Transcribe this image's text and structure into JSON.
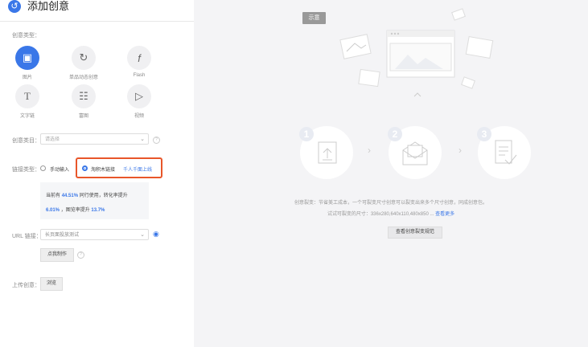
{
  "header": {
    "title": "添加创意",
    "back_icon": "back-arrow-icon"
  },
  "creative_type": {
    "label": "创意类型：",
    "items": [
      {
        "label": "图片",
        "icon": "image-icon",
        "active": true
      },
      {
        "label": "单品动态创意",
        "icon": "refresh-icon",
        "active": false
      },
      {
        "label": "Flash",
        "icon": "flash-icon",
        "active": false
      },
      {
        "label": "文字链",
        "icon": "text-icon",
        "active": false
      },
      {
        "label": "富图",
        "icon": "rich-media-icon",
        "active": false
      },
      {
        "label": "视频",
        "icon": "play-icon",
        "active": false
      }
    ]
  },
  "category": {
    "label": "创意类目：",
    "placeholder": "请选择"
  },
  "link_type": {
    "label": "链接类型：",
    "options": [
      {
        "label": "手动输入",
        "selected": false
      },
      {
        "label": "淘积木链接",
        "selected": true
      }
    ],
    "badge": "千人千面上线"
  },
  "tip": {
    "line1_prefix": "当前有",
    "line1_value": "44.51%",
    "line1_suffix": "同行使用，转化率提升",
    "line2_value1": "6.01%",
    "line2_mid": "，图览率提升",
    "line2_value2": "13.7%"
  },
  "url": {
    "label": "URL 链接：",
    "value": "长页面投放测试",
    "action": "点我制作"
  },
  "upload": {
    "label": "上传创意：",
    "button": "浏览"
  },
  "preview": {
    "sample_tag": "示意",
    "steps": [
      "1",
      "2",
      "3"
    ],
    "desc_line1": "创意裂变：节省美工成本，一个可裂变尺寸创意可以裂变出来多个尺寸创意，同成创意包。",
    "desc_line2_prefix": "试试可裂变的尺寸：336x280,640x110,480x850 ...",
    "desc_line2_link": "查看更多",
    "cta": "查看创意裂变规范"
  },
  "colors": {
    "accent": "#3a77e8",
    "highlight_border": "#e8562a",
    "panel_bg": "#f4f4f6"
  }
}
